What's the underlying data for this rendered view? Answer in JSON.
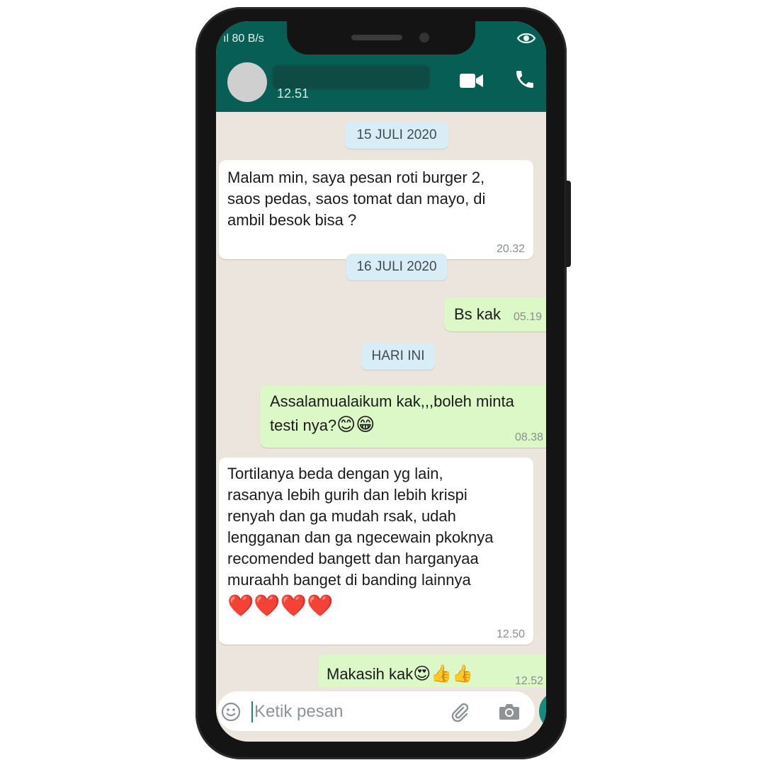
{
  "status_bar": {
    "network": "ıl 80 B/s",
    "eye_icon": "eye-icon"
  },
  "header": {
    "last_seen": "12.51",
    "video_icon": "video-call-icon",
    "call_icon": "phone-icon"
  },
  "messages": [
    {
      "type": "date",
      "text": "15 JULI 2020"
    },
    {
      "type": "incoming",
      "text": "Malam min, saya pesan roti burger 2,\nsaos pedas, saos tomat dan mayo, di\nambil besok bisa ?",
      "time": "20.32"
    },
    {
      "type": "date",
      "text": "16 JULI 2020"
    },
    {
      "type": "outgoing",
      "text": "Bs kak",
      "time": "05.19"
    },
    {
      "type": "date",
      "text": "HARI INI"
    },
    {
      "type": "outgoing",
      "text": "Assalamualaikum kak,,,boleh minta\ntesti nya?",
      "emoji": "😊😁",
      "time": "08.38"
    },
    {
      "type": "incoming",
      "text": "Tortilanya beda dengan yg lain,\nrasanya lebih gurih dan lebih krispi\nrenyah dan ga mudah rsak, udah\nlengganan dan ga ngecewain pkoknya\nrecomended bangett dan harganyaa\nmuraahh banget di banding lainnya",
      "emoji": "❤️❤️❤️❤️",
      "time": "12.50"
    },
    {
      "type": "outgoing",
      "text": "Makasih kak",
      "emoji": "😍👍👍",
      "time": "12.52"
    }
  ],
  "input": {
    "placeholder": "Ketik pesan"
  },
  "colors": {
    "header": "#075e54",
    "outgoing_bubble": "#dcf8c6",
    "incoming_bubble": "#ffffff",
    "date_chip": "#d9edf7",
    "accent": "#128c7e"
  }
}
